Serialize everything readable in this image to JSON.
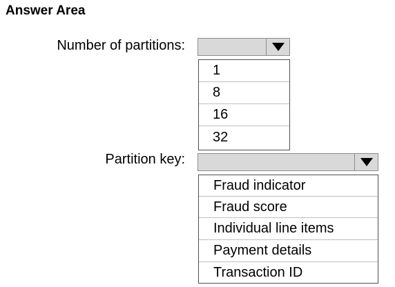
{
  "header": {
    "title": "Answer Area"
  },
  "partitions": {
    "label": "Number of partitions:",
    "options": [
      "1",
      "8",
      "16",
      "32"
    ]
  },
  "partition_key": {
    "label": "Partition key:",
    "options": [
      "Fraud indicator",
      "Fraud score",
      "Individual line items",
      "Payment details",
      "Transaction ID"
    ]
  },
  "icons": {
    "dropdown": "triangle-down-icon"
  }
}
